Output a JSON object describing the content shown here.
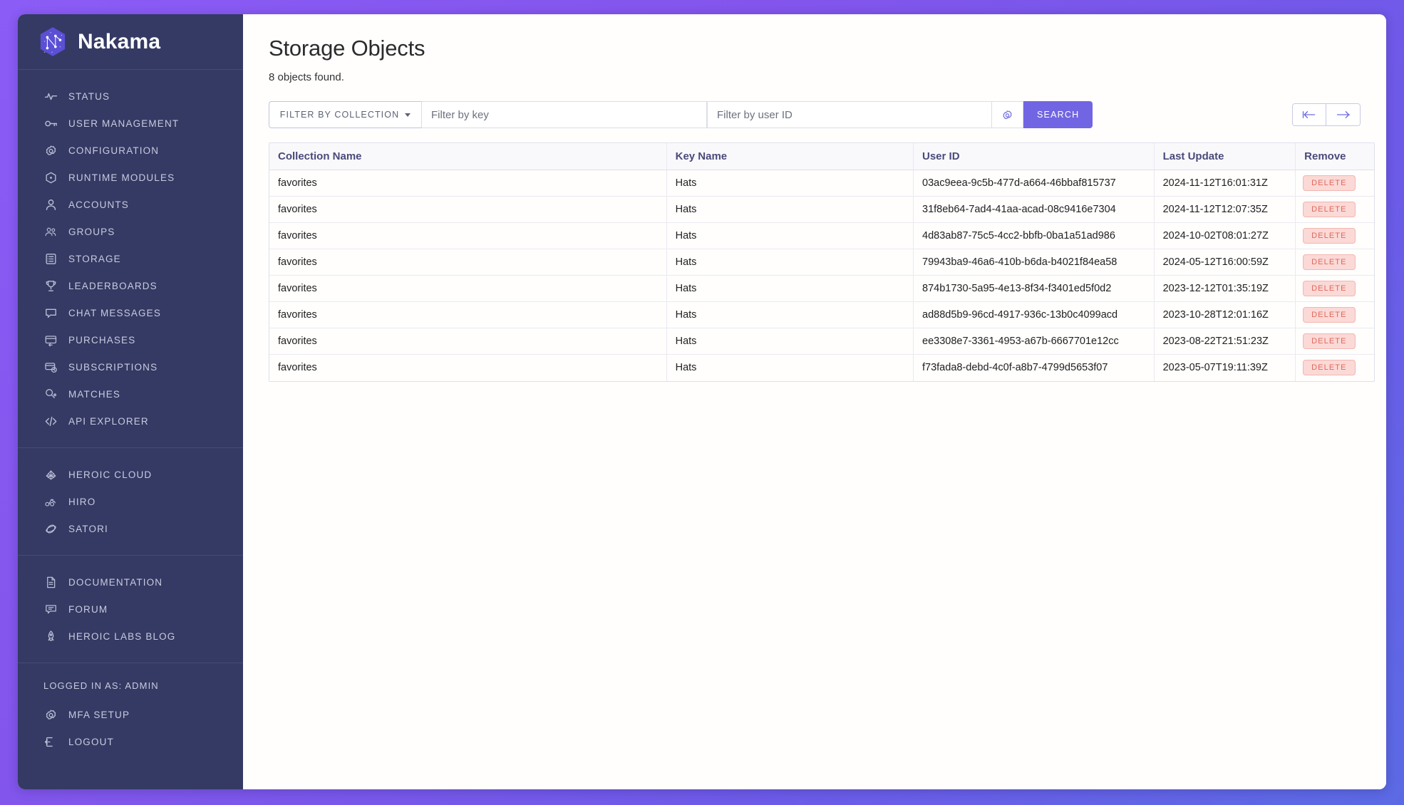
{
  "brand": {
    "name": "Nakama",
    "logo_icon": "nakama-hex-logo"
  },
  "sidebar": {
    "groups": [
      {
        "items": [
          {
            "label": "STATUS",
            "icon": "activity-pulse-icon"
          },
          {
            "label": "USER MANAGEMENT",
            "icon": "key-icon"
          },
          {
            "label": "CONFIGURATION",
            "icon": "gear-icon"
          },
          {
            "label": "RUNTIME MODULES",
            "icon": "hexagon-dot-icon"
          },
          {
            "label": "ACCOUNTS",
            "icon": "user-icon"
          },
          {
            "label": "GROUPS",
            "icon": "users-group-icon"
          },
          {
            "label": "STORAGE",
            "icon": "server-list-icon"
          },
          {
            "label": "LEADERBOARDS",
            "icon": "trophy-icon"
          },
          {
            "label": "CHAT MESSAGES",
            "icon": "chat-bubble-icon"
          },
          {
            "label": "PURCHASES",
            "icon": "card-return-icon"
          },
          {
            "label": "SUBSCRIPTIONS",
            "icon": "card-clock-icon"
          },
          {
            "label": "MATCHES",
            "icon": "match-search-icon"
          },
          {
            "label": "API EXPLORER",
            "icon": "code-brackets-icon"
          }
        ]
      },
      {
        "items": [
          {
            "label": "HEROIC CLOUD",
            "icon": "heroic-cloud-icon"
          },
          {
            "label": "HIRO",
            "icon": "hiro-icon"
          },
          {
            "label": "SATORI",
            "icon": "satori-icon"
          }
        ]
      },
      {
        "items": [
          {
            "label": "DOCUMENTATION",
            "icon": "document-icon"
          },
          {
            "label": "FORUM",
            "icon": "forum-bubble-icon"
          },
          {
            "label": "HEROIC LABS BLOG",
            "icon": "rocket-icon"
          }
        ]
      }
    ],
    "account": {
      "logged_in_label": "LOGGED IN AS: ADMIN",
      "items": [
        {
          "label": "MFA SETUP",
          "icon": "gear-icon"
        },
        {
          "label": "LOGOUT",
          "icon": "logout-icon"
        }
      ]
    }
  },
  "main": {
    "title": "Storage Objects",
    "subtitle": "8 objects found.",
    "toolbar": {
      "collection_filter_label": "FILTER BY COLLECTION",
      "key_placeholder": "Filter by key",
      "key_value": "",
      "user_placeholder": "Filter by user ID",
      "user_value": "",
      "gear_icon": "gear-icon",
      "search_label": "SEARCH",
      "pager": {
        "first_icon": "arrow-to-start-icon",
        "next_icon": "arrow-right-icon"
      }
    },
    "table": {
      "columns": [
        "Collection Name",
        "Key Name",
        "User ID",
        "Last Update",
        "Remove"
      ],
      "delete_label": "DELETE",
      "rows": [
        {
          "collection": "favorites",
          "key": "Hats",
          "user_id": "03ac9eea-9c5b-477d-a664-46bbaf815737",
          "last_update": "2024-11-12T16:01:31Z"
        },
        {
          "collection": "favorites",
          "key": "Hats",
          "user_id": "31f8eb64-7ad4-41aa-acad-08c9416e7304",
          "last_update": "2024-11-12T12:07:35Z"
        },
        {
          "collection": "favorites",
          "key": "Hats",
          "user_id": "4d83ab87-75c5-4cc2-bbfb-0ba1a51ad986",
          "last_update": "2024-10-02T08:01:27Z"
        },
        {
          "collection": "favorites",
          "key": "Hats",
          "user_id": "79943ba9-46a6-410b-b6da-b4021f84ea58",
          "last_update": "2024-05-12T16:00:59Z"
        },
        {
          "collection": "favorites",
          "key": "Hats",
          "user_id": "874b1730-5a95-4e13-8f34-f3401ed5f0d2",
          "last_update": "2023-12-12T01:35:19Z"
        },
        {
          "collection": "favorites",
          "key": "Hats",
          "user_id": "ad88d5b9-96cd-4917-936c-13b0c4099acd",
          "last_update": "2023-10-28T12:01:16Z"
        },
        {
          "collection": "favorites",
          "key": "Hats",
          "user_id": "ee3308e7-3361-4953-a67b-6667701e12cc",
          "last_update": "2023-08-22T21:51:23Z"
        },
        {
          "collection": "favorites",
          "key": "Hats",
          "user_id": "f73fada8-debd-4c0f-a8b7-4799d5653f07",
          "last_update": "2023-05-07T19:11:39Z"
        }
      ]
    }
  },
  "colors": {
    "sidebar_bg": "#343a63",
    "accent": "#7165e3",
    "page_gradient_start": "#8b5cf6",
    "page_gradient_end": "#5b6ae4",
    "header_text": "#4a4a7a",
    "delete_red": "#e0685c"
  }
}
